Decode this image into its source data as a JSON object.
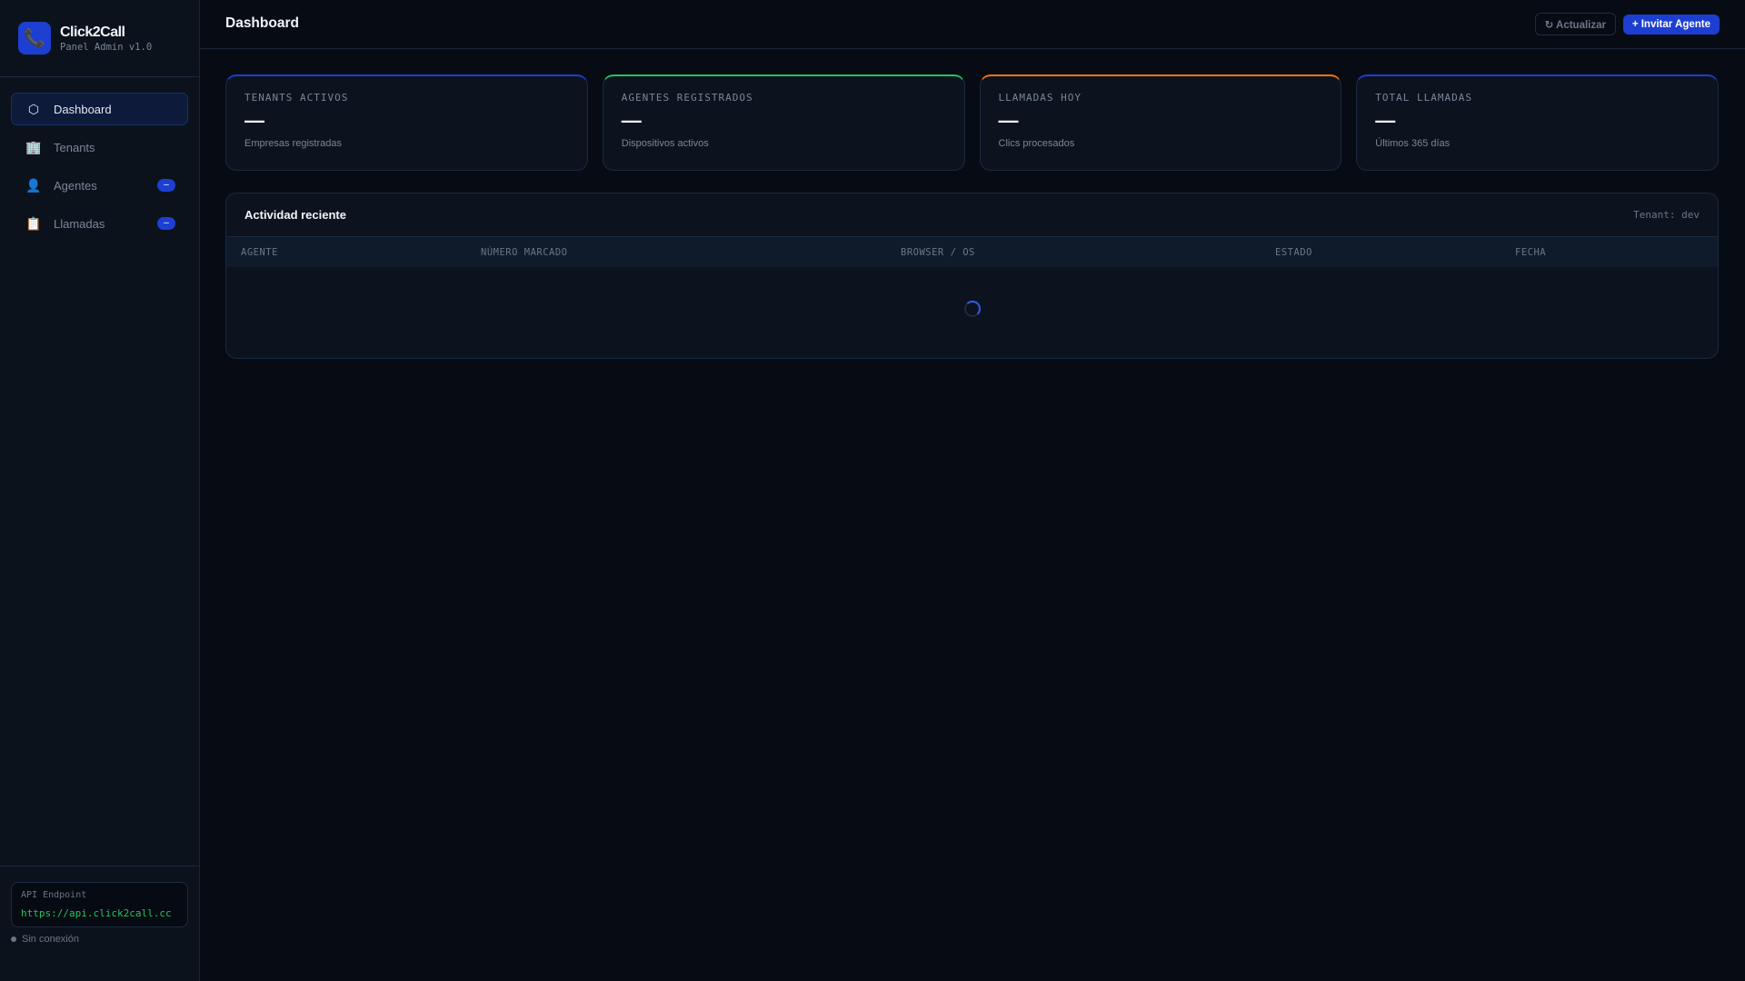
{
  "sidebar": {
    "brand": {
      "name": "Click2Call",
      "subtitle": "Panel Admin v1.0",
      "icon": "phone-icon"
    },
    "items": [
      {
        "label": "Dashboard",
        "icon": "hexagon-icon",
        "glyph": "⬡",
        "active": true
      },
      {
        "label": "Tenants",
        "icon": "building-icon",
        "glyph": "🏢"
      },
      {
        "label": "Agentes",
        "icon": "user-icon",
        "glyph": "👤",
        "badge": "–"
      },
      {
        "label": "Llamadas",
        "icon": "clipboard-icon",
        "glyph": "📋",
        "badge": "–"
      }
    ],
    "api": {
      "label": "API Endpoint",
      "url": "https://api.click2call.cc"
    },
    "status": "Sin conexión"
  },
  "header": {
    "title": "Dashboard",
    "refresh_label": "↻ Actualizar",
    "invite_label": "+ Invitar Agente"
  },
  "stats": [
    {
      "label": "TENANTS ACTIVOS",
      "value": "—",
      "sub": "Empresas registradas",
      "color": "#1d3fd1"
    },
    {
      "label": "AGENTES REGISTRADOS",
      "value": "—",
      "sub": "Dispositivos activos",
      "color": "#22c55e"
    },
    {
      "label": "LLAMADAS HOY",
      "value": "—",
      "sub": "Clics procesados",
      "color": "#f97316"
    },
    {
      "label": "TOTAL LLAMADAS",
      "value": "—",
      "sub": "Últimos 365 días",
      "color": "#1d3fd1"
    }
  ],
  "activity": {
    "title": "Actividad reciente",
    "tenant": "Tenant: dev",
    "columns": [
      "AGENTE",
      "NÚMERO MARCADO",
      "BROWSER / OS",
      "ESTADO",
      "FECHA"
    ]
  }
}
